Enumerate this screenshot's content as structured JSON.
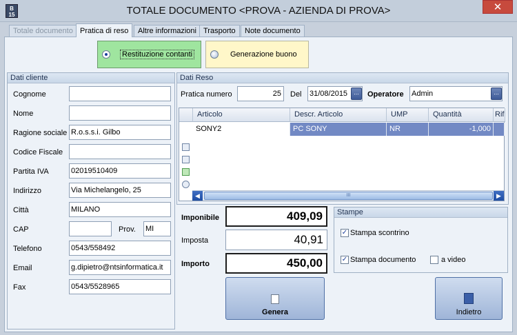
{
  "window": {
    "title": "TOTALE DOCUMENTO <PROVA - AZIENDA DI PROVA>",
    "app_icon_text": "B\n15",
    "close_glyph": "✕"
  },
  "tabs": [
    {
      "label": "Totale documento",
      "state": "disabled"
    },
    {
      "label": "Pratica di reso",
      "state": "active"
    },
    {
      "label": "Altre informazioni",
      "state": "normal"
    },
    {
      "label": "Trasporto",
      "state": "normal"
    },
    {
      "label": "Note documento",
      "state": "normal"
    }
  ],
  "mode_options": {
    "restituzione": {
      "label": "Restituzione contanti",
      "checked": true,
      "color": "#9fe59f"
    },
    "generazione": {
      "label": "Generazione buono",
      "checked": false,
      "color": "#fff7c9"
    }
  },
  "dati_cliente": {
    "header": "Dati cliente",
    "fields": {
      "cognome": {
        "label": "Cognome",
        "value": ""
      },
      "nome": {
        "label": "Nome",
        "value": ""
      },
      "ragione_sociale": {
        "label": "Ragione sociale",
        "value": "R.o.s.s.i. Gilbo"
      },
      "codice_fiscale": {
        "label": "Codice Fiscale",
        "value": ""
      },
      "partita_iva": {
        "label": "Partita IVA",
        "value": "02019510409"
      },
      "indirizzo": {
        "label": "Indirizzo",
        "value": "Via Michelangelo, 25"
      },
      "citta": {
        "label": "Città",
        "value": "MILANO"
      },
      "cap": {
        "label": "CAP",
        "value": ""
      },
      "prov": {
        "label": "Prov.",
        "value": "MI"
      },
      "telefono": {
        "label": "Telefono",
        "value": "0543/558492"
      },
      "email": {
        "label": "Email",
        "value": "g.dipietro@ntsinformatica.it"
      },
      "fax": {
        "label": "Fax",
        "value": "0543/5528965"
      }
    }
  },
  "dati_reso": {
    "header": "Dati Reso",
    "pratica_numero_label": "Pratica numero",
    "pratica_numero": "25",
    "del_label": "Del",
    "data": "31/08/2015",
    "operatore_label": "Operatore",
    "operatore": "Admin",
    "ellipsis_glyph": "..."
  },
  "grid": {
    "columns": [
      "Articolo",
      "Descr. Articolo",
      "UMP",
      "Quantità",
      "Rif"
    ],
    "rows": [
      {
        "articolo": "SONY2",
        "descr": "PC SONY",
        "ump": "NR",
        "quantita": "-1,000",
        "rif": ""
      }
    ],
    "scroll_left": "◀",
    "scroll_right": "▶",
    "scroll_thumb_grip": "III"
  },
  "totals": {
    "imponibile_label": "Imponibile",
    "imponibile": "409,09",
    "imposta_label": "Imposta",
    "imposta": "40,91",
    "importo_label": "Importo",
    "importo": "450,00"
  },
  "stampe": {
    "header": "Stampe",
    "stampa_scontrino": {
      "label": "Stampa scontrino",
      "checked": true
    },
    "stampa_documento": {
      "label": "Stampa documento",
      "checked": true
    },
    "a_video": {
      "label": "a video",
      "checked": false
    },
    "check_glyph": "✓"
  },
  "buttons": {
    "genera": "Genera",
    "indietro": "Indietro"
  }
}
